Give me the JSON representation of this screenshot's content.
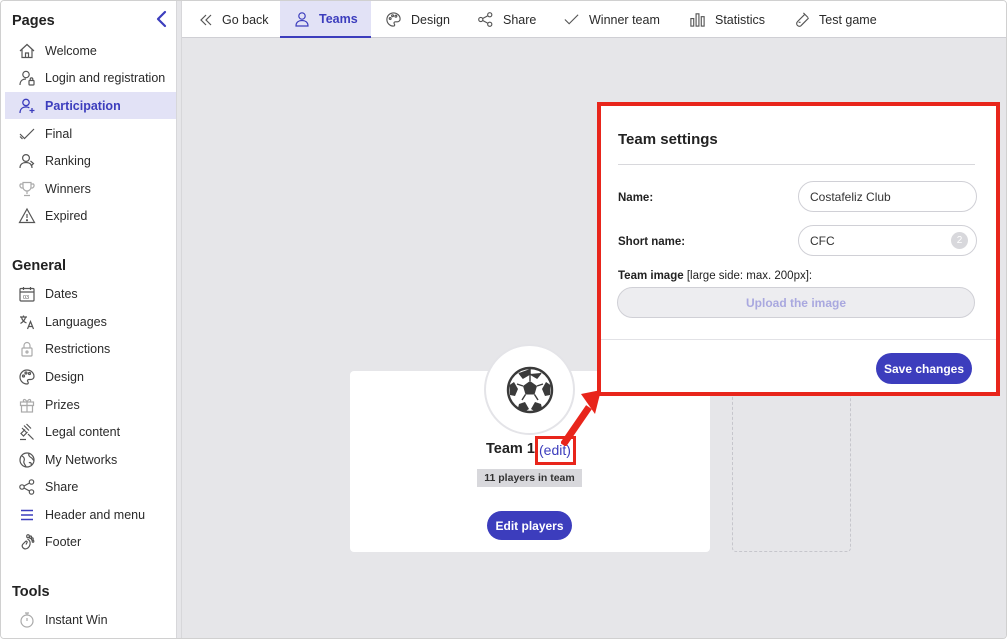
{
  "sidebar": {
    "pages_title": "Pages",
    "pages": [
      {
        "label": "Welcome",
        "icon": "home-icon"
      },
      {
        "label": "Login and registration",
        "icon": "user-lock-icon"
      },
      {
        "label": "Participation",
        "icon": "user-add-icon",
        "active": true
      },
      {
        "label": "Final",
        "icon": "check-icon"
      },
      {
        "label": "Ranking",
        "icon": "ranking-icon"
      },
      {
        "label": "Winners",
        "icon": "trophy-icon"
      },
      {
        "label": "Expired",
        "icon": "warning-icon"
      }
    ],
    "general_title": "General",
    "general": [
      {
        "label": "Dates",
        "icon": "calendar-icon"
      },
      {
        "label": "Languages",
        "icon": "translate-icon"
      },
      {
        "label": "Restrictions",
        "icon": "lock-icon"
      },
      {
        "label": "Design",
        "icon": "palette-icon"
      },
      {
        "label": "Prizes",
        "icon": "gift-icon"
      },
      {
        "label": "Legal content",
        "icon": "gavel-icon"
      },
      {
        "label": "My Networks",
        "icon": "globe-icon"
      },
      {
        "label": "Share",
        "icon": "share-icon"
      },
      {
        "label": "Header and menu",
        "icon": "menu-icon"
      },
      {
        "label": "Footer",
        "icon": "footer-icon"
      }
    ],
    "tools_title": "Tools",
    "tools": [
      {
        "label": "Instant Win",
        "icon": "timer-icon"
      }
    ]
  },
  "tabs": [
    {
      "label": "Go back",
      "icon": "double-chevron-left-icon"
    },
    {
      "label": "Teams",
      "icon": "user-icon",
      "active": true
    },
    {
      "label": "Design",
      "icon": "palette-icon"
    },
    {
      "label": "Share",
      "icon": "share-icon"
    },
    {
      "label": "Winner team",
      "icon": "check-icon"
    },
    {
      "label": "Statistics",
      "icon": "bar-chart-icon"
    },
    {
      "label": "Test game",
      "icon": "test-tube-icon"
    }
  ],
  "team_card": {
    "name": "Team 1",
    "edit_label": "(edit)",
    "players_badge": "11 players in team",
    "edit_players_label": "Edit players"
  },
  "modal": {
    "title": "Team settings",
    "name_label": "Name:",
    "name_value": "Costafeliz Club",
    "short_name_label": "Short name:",
    "short_name_value": "CFC",
    "short_name_counter": "2",
    "image_label_bold": "Team image",
    "image_label_hint": "[large side: max. 200px]:",
    "upload_label": "Upload the image",
    "save_label": "Save changes"
  },
  "colors": {
    "accent": "#3c3dbd",
    "active_bg": "#e2e2f6",
    "highlight": "#e8251b",
    "canvas": "#e6e6e9"
  }
}
